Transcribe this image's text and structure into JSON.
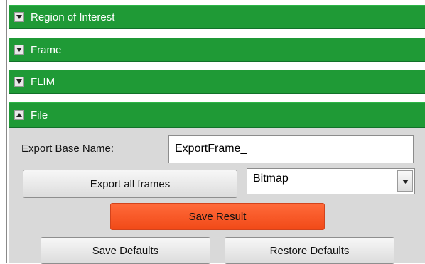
{
  "panels": [
    {
      "label": "Region of Interest",
      "expanded": false,
      "icon": "expand-arrow-icon"
    },
    {
      "label": "Frame",
      "expanded": false,
      "icon": "expand-arrow-icon"
    },
    {
      "label": "FLIM",
      "expanded": false,
      "icon": "expand-arrow-icon"
    },
    {
      "label": "File",
      "expanded": true,
      "icon": "collapse-arrow-icon"
    }
  ],
  "file": {
    "export_base_name_label": "Export Base Name:",
    "export_base_name_value": "ExportFrame_",
    "export_all_frames_label": "Export all frames",
    "format_selected": "Bitmap",
    "save_result_label": "Save Result",
    "save_defaults_label": "Save Defaults",
    "restore_defaults_label": "Restore Defaults"
  },
  "colors": {
    "panel_header": "#1f9a36",
    "accent_button": "#f14a18",
    "body_background": "#d9d9d9"
  }
}
